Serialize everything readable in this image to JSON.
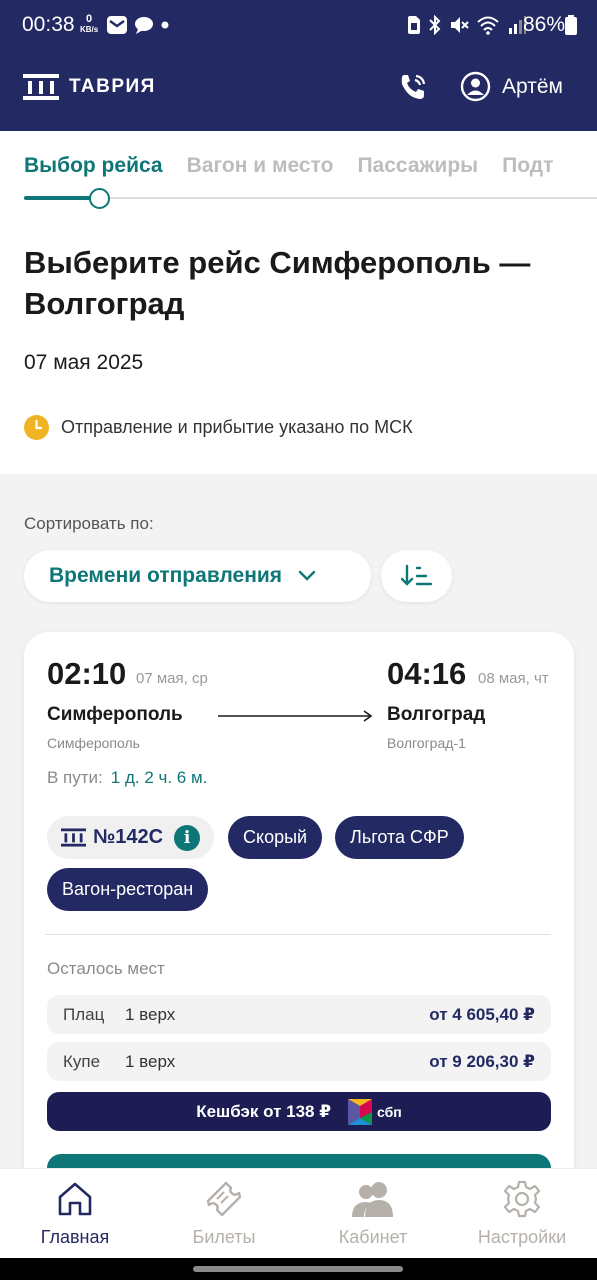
{
  "status_bar": {
    "time": "00:38",
    "net_speed_value": "0",
    "net_speed_unit": "KB/s",
    "battery": "86%"
  },
  "app_bar": {
    "logo_text": "ТАВРИЯ",
    "user_name": "Артём"
  },
  "steps": [
    {
      "label": "Выбор рейса",
      "active": true
    },
    {
      "label": "Вагон и место",
      "active": false
    },
    {
      "label": "Пассажиры",
      "active": false
    },
    {
      "label": "Подт",
      "active": false
    }
  ],
  "page": {
    "title": "Выберите рейс Симферополь — Волгоград",
    "date": "07 мая 2025",
    "timezone_note": "Отправление и прибытие указано по МСК"
  },
  "sort": {
    "label": "Сортировать по:",
    "selected": "Времени отправления"
  },
  "trip": {
    "departure_time": "02:10",
    "departure_date": "07 мая, ср",
    "arrival_time": "04:16",
    "arrival_date": "08 мая, чт",
    "departure_city": "Симферополь",
    "arrival_city": "Волгоград",
    "departure_station": "Симферополь",
    "arrival_station": "Волгоград-1",
    "duration_label": "В пути:",
    "duration_value": "1 д. 2 ч. 6 м.",
    "train_number": "№142С",
    "tags": [
      "Скорый",
      "Льгота СФР",
      "Вагон-ресторан"
    ],
    "seats_left_label": "Осталось мест",
    "seats": [
      {
        "class": "Плац",
        "place": "1 верх",
        "price": "от 4 605,40 ₽"
      },
      {
        "class": "Купе",
        "place": "1 верх",
        "price": "от 9 206,30 ₽"
      }
    ],
    "cashback": "Кешбэк от 138 ₽",
    "cashback_brand": "сбп"
  },
  "bottom_nav": [
    {
      "label": "Главная",
      "icon": "home-icon",
      "active": true
    },
    {
      "label": "Билеты",
      "icon": "ticket-icon",
      "active": false
    },
    {
      "label": "Кабинет",
      "icon": "users-icon",
      "active": false
    },
    {
      "label": "Настройки",
      "icon": "gear-icon",
      "active": false
    }
  ],
  "colors": {
    "brand_navy": "#232a63",
    "accent_teal": "#0f7677",
    "clock_yellow": "#f0b323"
  }
}
